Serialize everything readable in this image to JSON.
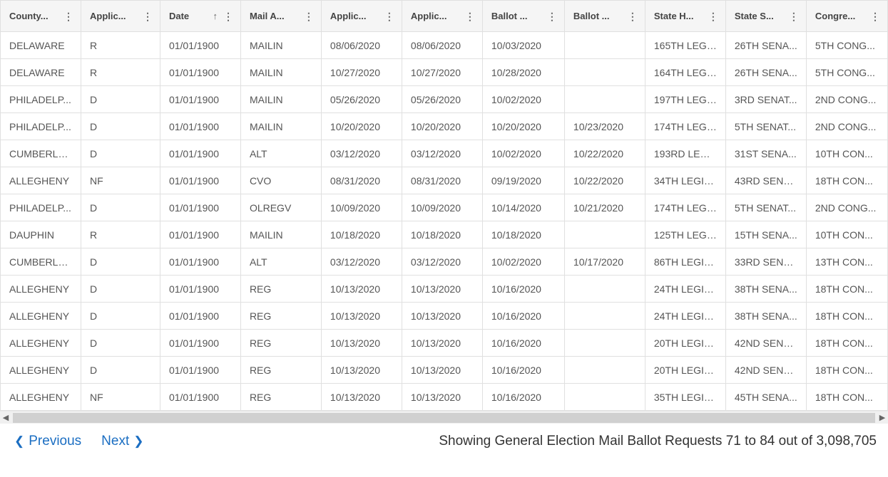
{
  "columns": [
    {
      "label": "County...",
      "sort": null
    },
    {
      "label": "Applic...",
      "sort": null
    },
    {
      "label": "Date",
      "sort": "asc"
    },
    {
      "label": "Mail A...",
      "sort": null
    },
    {
      "label": "Applic...",
      "sort": null
    },
    {
      "label": "Applic...",
      "sort": null
    },
    {
      "label": "Ballot ...",
      "sort": null
    },
    {
      "label": "Ballot ...",
      "sort": null
    },
    {
      "label": "State H...",
      "sort": null
    },
    {
      "label": "State S...",
      "sort": null
    },
    {
      "label": "Congre...",
      "sort": null
    }
  ],
  "rows": [
    [
      "DELAWARE",
      "R",
      "01/01/1900",
      "MAILIN",
      "08/06/2020",
      "08/06/2020",
      "10/03/2020",
      "",
      "165TH LEGI...",
      "26TH SENA...",
      "5TH CONG..."
    ],
    [
      "DELAWARE",
      "R",
      "01/01/1900",
      "MAILIN",
      "10/27/2020",
      "10/27/2020",
      "10/28/2020",
      "",
      "164TH LEGI...",
      "26TH SENA...",
      "5TH CONG..."
    ],
    [
      "PHILADELP...",
      "D",
      "01/01/1900",
      "MAILIN",
      "05/26/2020",
      "05/26/2020",
      "10/02/2020",
      "",
      "197TH LEGI...",
      "3RD SENAT...",
      "2ND CONG..."
    ],
    [
      "PHILADELP...",
      "D",
      "01/01/1900",
      "MAILIN",
      "10/20/2020",
      "10/20/2020",
      "10/20/2020",
      "10/23/2020",
      "174TH LEGI...",
      "5TH SENAT...",
      "2ND CONG..."
    ],
    [
      "CUMBERLA...",
      "D",
      "01/01/1900",
      "ALT",
      "03/12/2020",
      "03/12/2020",
      "10/02/2020",
      "10/22/2020",
      "193RD LEGI...",
      "31ST SENA...",
      "10TH CON..."
    ],
    [
      "ALLEGHENY",
      "NF",
      "01/01/1900",
      "CVO",
      "08/31/2020",
      "08/31/2020",
      "09/19/2020",
      "10/22/2020",
      "34TH LEGIS...",
      "43RD SENA...",
      "18TH CON..."
    ],
    [
      "PHILADELP...",
      "D",
      "01/01/1900",
      "OLREGV",
      "10/09/2020",
      "10/09/2020",
      "10/14/2020",
      "10/21/2020",
      "174TH LEGI...",
      "5TH SENAT...",
      "2ND CONG..."
    ],
    [
      "DAUPHIN",
      "R",
      "01/01/1900",
      "MAILIN",
      "10/18/2020",
      "10/18/2020",
      "10/18/2020",
      "",
      "125TH LEGI...",
      "15TH SENA...",
      "10TH CON..."
    ],
    [
      "CUMBERLA...",
      "D",
      "01/01/1900",
      "ALT",
      "03/12/2020",
      "03/12/2020",
      "10/02/2020",
      "10/17/2020",
      "86TH LEGIS...",
      "33RD SENA...",
      "13TH CON..."
    ],
    [
      "ALLEGHENY",
      "D",
      "01/01/1900",
      "REG",
      "10/13/2020",
      "10/13/2020",
      "10/16/2020",
      "",
      "24TH LEGIS...",
      "38TH SENA...",
      "18TH CON..."
    ],
    [
      "ALLEGHENY",
      "D",
      "01/01/1900",
      "REG",
      "10/13/2020",
      "10/13/2020",
      "10/16/2020",
      "",
      "24TH LEGIS...",
      "38TH SENA...",
      "18TH CON..."
    ],
    [
      "ALLEGHENY",
      "D",
      "01/01/1900",
      "REG",
      "10/13/2020",
      "10/13/2020",
      "10/16/2020",
      "",
      "20TH LEGIS...",
      "42ND SENA...",
      "18TH CON..."
    ],
    [
      "ALLEGHENY",
      "D",
      "01/01/1900",
      "REG",
      "10/13/2020",
      "10/13/2020",
      "10/16/2020",
      "",
      "20TH LEGIS...",
      "42ND SENA...",
      "18TH CON..."
    ],
    [
      "ALLEGHENY",
      "NF",
      "01/01/1900",
      "REG",
      "10/13/2020",
      "10/13/2020",
      "10/16/2020",
      "",
      "35TH LEGIS...",
      "45TH SENA...",
      "18TH CON..."
    ]
  ],
  "pager": {
    "previous": "Previous",
    "next": "Next"
  },
  "status": "Showing General Election Mail Ballot Requests 71 to 84 out of 3,098,705"
}
